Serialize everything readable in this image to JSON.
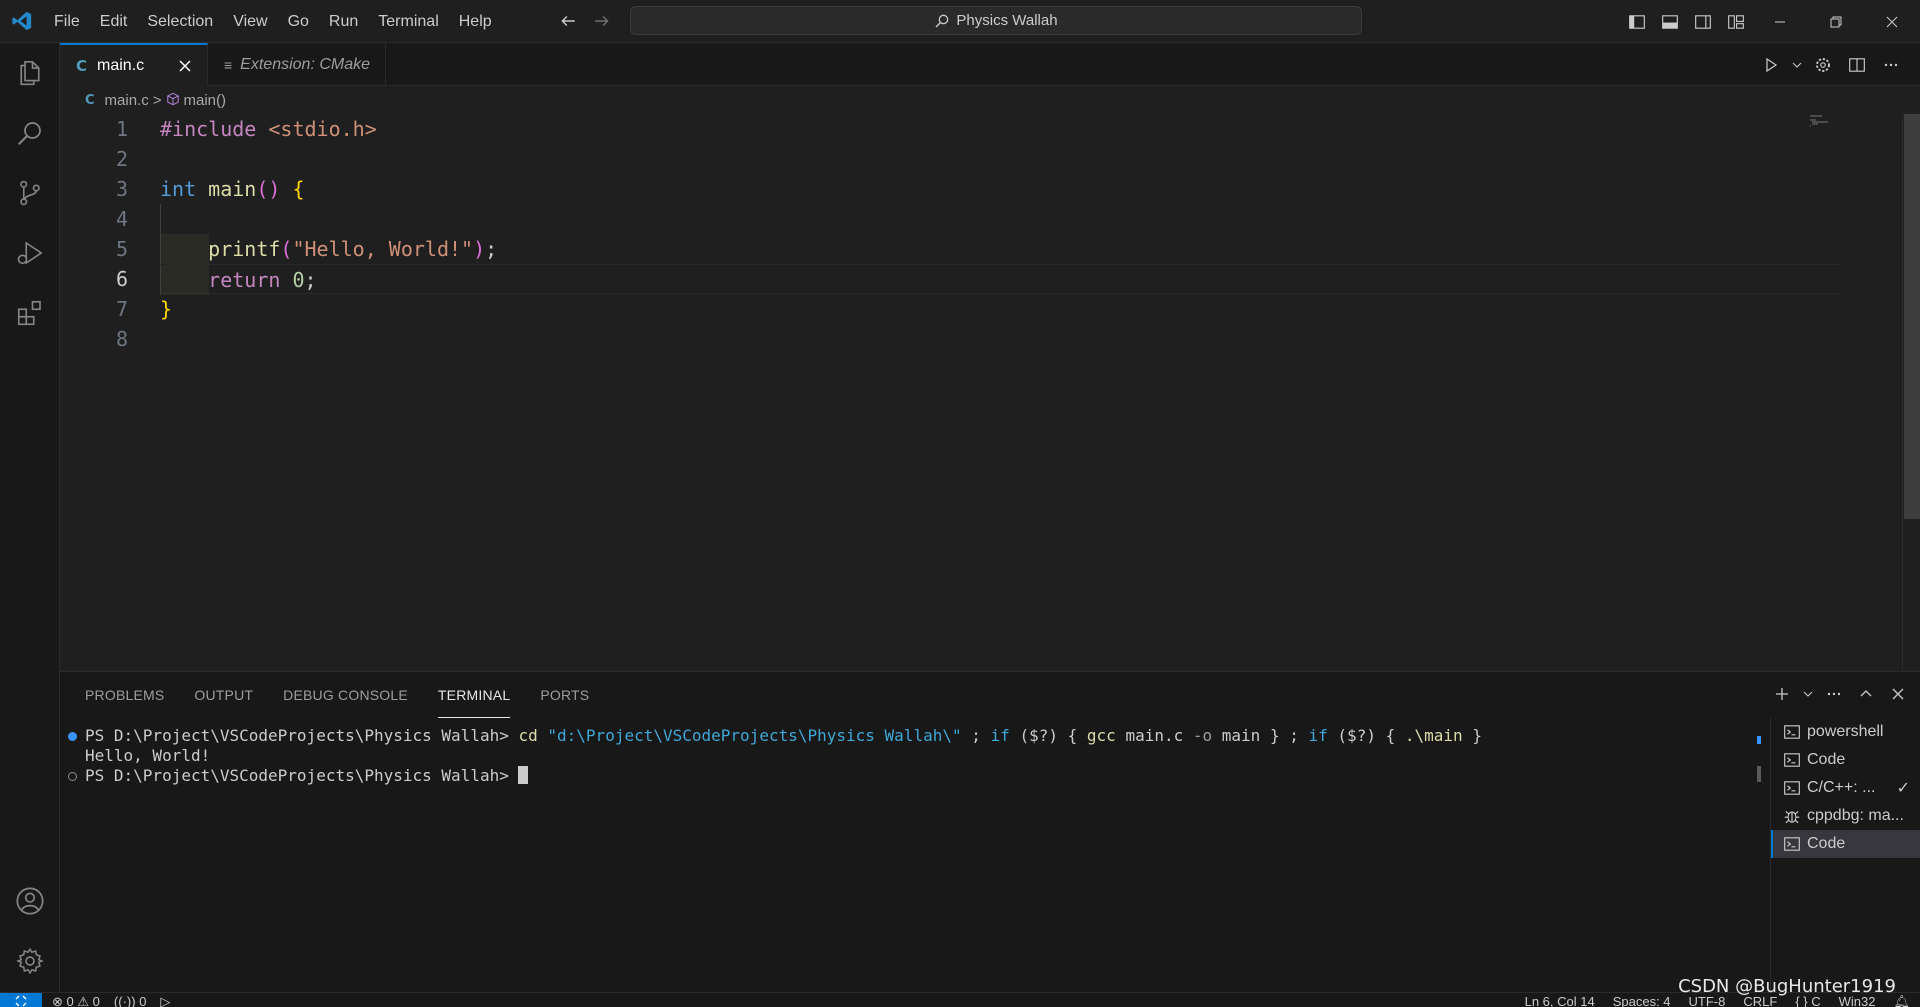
{
  "menu": [
    "File",
    "Edit",
    "Selection",
    "View",
    "Go",
    "Run",
    "Terminal",
    "Help"
  ],
  "command_center": "Physics Wallah",
  "tabs": [
    {
      "glyph": "C",
      "label": "main.c",
      "active": true
    },
    {
      "glyph": "≡",
      "label": "Extension: CMake",
      "active": false
    }
  ],
  "breadcrumb": {
    "file_glyph": "C",
    "file": "main.c",
    "separator": ">",
    "symbol": "main()"
  },
  "editor": {
    "line_numbers": [
      "1",
      "2",
      "3",
      "4",
      "5",
      "6",
      "7",
      "8"
    ],
    "current_line": "6"
  },
  "code_tokens": {
    "l1_pre": "#include",
    "l1_hdr": " <stdio.h>",
    "l3_type": "int",
    "l3_fn": "main",
    "l3_paren": "()",
    "l3_brace": "{",
    "l5_fn": "printf",
    "l5_open": "(",
    "l5_str": "\"Hello, World!\"",
    "l5_close": ")",
    "l5_semi": ";",
    "l6_kw": "return",
    "l6_num": "0",
    "l6_semi": ";",
    "l7_brace": "}"
  },
  "panel": {
    "tabs": [
      "PROBLEMS",
      "OUTPUT",
      "DEBUG CONSOLE",
      "TERMINAL",
      "PORTS"
    ],
    "active_tab": "TERMINAL"
  },
  "terminal": {
    "prompt": "PS D:\\Project\\VSCodeProjects\\Physics Wallah>",
    "cmd_cd": "cd",
    "cmd_path": "\"d:\\Project\\VSCodeProjects\\Physics Wallah\\\"",
    "semi1": ";",
    "if1": "if",
    "cond1": "($?)",
    "open1": "{",
    "gcc": "gcc",
    "gcc_src": "main.c",
    "gcc_flag": "-o",
    "gcc_out": "main",
    "close1": "}",
    "semi2": ";",
    "if2": "if",
    "cond2": "($?)",
    "open2": "{",
    "run": ".\\main",
    "close2": "}",
    "output": "Hello, World!",
    "prompt2": "PS D:\\Project\\VSCodeProjects\\Physics Wallah>"
  },
  "terminal_list": [
    {
      "icon": "terminal-icon",
      "label": "powershell",
      "selected": false
    },
    {
      "icon": "terminal-icon",
      "label": "Code",
      "selected": false
    },
    {
      "icon": "terminal-icon",
      "label": "C/C++: ...",
      "selected": false,
      "check": "✓"
    },
    {
      "icon": "debug-icon",
      "label": "cppdbg: ma...",
      "selected": false
    },
    {
      "icon": "terminal-icon",
      "label": "Code",
      "selected": true
    }
  ],
  "statusbar": {
    "errors": "0",
    "warnings": "0",
    "ports": "0",
    "position": "Ln 6, Col 14",
    "spaces": "Spaces: 4",
    "encoding": "UTF-8",
    "eol": "CRLF",
    "language": "{ } C",
    "platform": "Win32"
  },
  "watermark": "CSDN @BugHunter1919",
  "colors": {
    "accent": "#0078d4",
    "background": "#1f1f1f",
    "sidebar": "#181818"
  }
}
